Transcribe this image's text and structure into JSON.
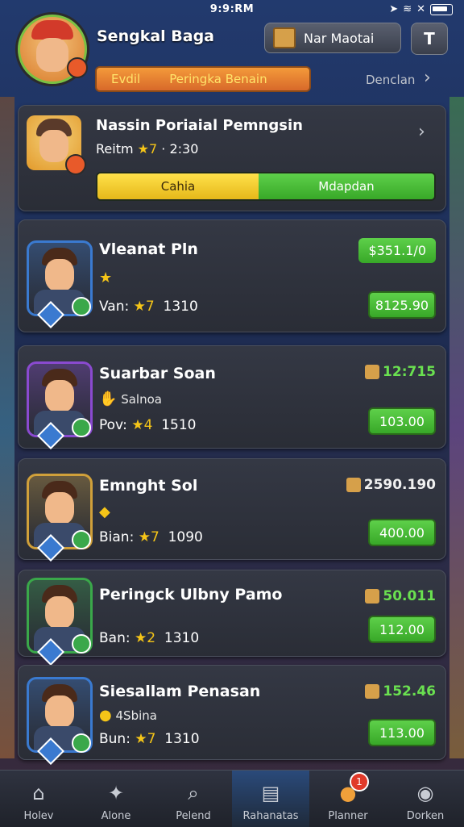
{
  "status": {
    "time": "9:9:RM",
    "icons": [
      "location-icon",
      "wifi-icon",
      "signal-icon",
      "battery-icon"
    ]
  },
  "header": {
    "player_name": "Sengkal Baga",
    "top_button_label": "Nar Maotai",
    "square_button_glyph": "T",
    "tab_bar": {
      "left": "Evdil",
      "right": "Peringka Benain"
    },
    "side_link": "Denclan"
  },
  "highlight": {
    "title": "Nassin Poriaial Pemngsin",
    "subtitle_prefix": "Reitm",
    "subtitle_num": "7",
    "subtitle_suffix": "2:30",
    "split_left": "Cahia",
    "split_right": "Mdapdan"
  },
  "items": [
    {
      "name": "Vleanat Pln",
      "tag": "",
      "tag_icon": "star",
      "stat_label": "Van:",
      "stat_stars": "7",
      "stat_value": "1310",
      "price_top": "$351.1/0",
      "price_top_style": "box",
      "price_btn": "8125.90",
      "accent": "#3a7ad0"
    },
    {
      "name": "Suarbar Soan",
      "tag": "Salnoa",
      "tag_icon": "hand",
      "stat_label": "Pov:",
      "stat_stars": "4",
      "stat_value": "1510",
      "price_top": "12:715",
      "price_top_style": "icon",
      "price_btn": "103.00",
      "accent": "#8a4ad0"
    },
    {
      "name": "Emnght Sol",
      "tag": "",
      "tag_icon": "gem",
      "stat_label": "Bian:",
      "stat_stars": "7",
      "stat_value": "1090",
      "price_top": "2590.190",
      "price_top_style": "icon-white",
      "price_btn": "400.00",
      "accent": "#d0a03a"
    },
    {
      "name": "Peringck Ulbny Pamo",
      "tag": "",
      "tag_icon": "",
      "stat_label": "Ban:",
      "stat_stars": "2",
      "stat_value": "1310",
      "price_top": "50.011",
      "price_top_style": "icon",
      "price_btn": "112.00",
      "accent": "#3aa84a"
    },
    {
      "name": "Siesallam Penasan",
      "tag": "4Sbina",
      "tag_icon": "coin",
      "stat_label": "Bun:",
      "stat_stars": "7",
      "stat_value": "1310",
      "price_top": "152.46",
      "price_top_style": "icon",
      "price_btn": "113.00",
      "accent": "#3a7ad0"
    }
  ],
  "nav": [
    {
      "label": "Holev",
      "icon": "home-icon"
    },
    {
      "label": "Alone",
      "icon": "puzzle-icon"
    },
    {
      "label": "Pelend",
      "icon": "search-icon"
    },
    {
      "label": "Rahanatas",
      "icon": "server-icon",
      "active": true
    },
    {
      "label": "Planner",
      "icon": "chat-icon",
      "badge": "1"
    },
    {
      "label": "Dorken",
      "icon": "user-icon"
    }
  ]
}
